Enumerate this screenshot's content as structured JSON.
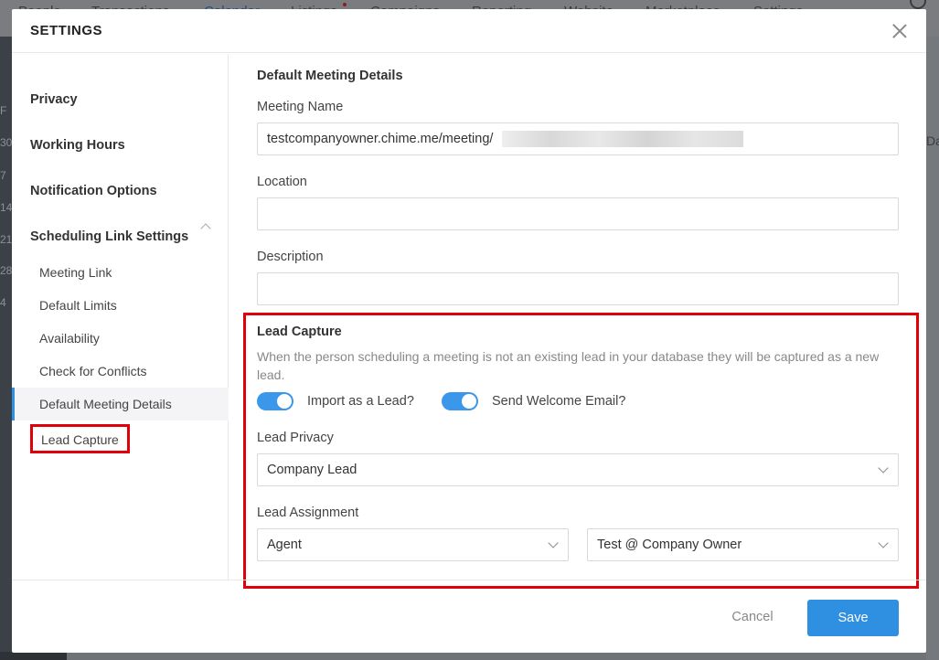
{
  "background": {
    "nav": [
      "People",
      "Transactions",
      "Calendar",
      "Listings",
      "Campaigns",
      "Reporting",
      "Website",
      "Marketplace",
      "Settings"
    ],
    "active_nav": "Calendar",
    "rail_numbers": [
      "F",
      "30",
      "7",
      "14",
      "21",
      "28",
      "4"
    ],
    "right_text": "Da"
  },
  "modal": {
    "title": "SETTINGS",
    "close_icon": "close-icon"
  },
  "sidebar": {
    "privacy": "Privacy",
    "working_hours": "Working Hours",
    "notification_options": "Notification Options",
    "scheduling_link_settings": "Scheduling Link Settings",
    "sub": [
      "Meeting Link",
      "Default Limits",
      "Availability",
      "Check for Conflicts",
      "Default Meeting Details",
      "Lead Capture"
    ]
  },
  "meeting": {
    "section_title": "Default Meeting Details",
    "name_label": "Meeting Name",
    "name_value": "testcompanyowner.chime.me/meeting/",
    "location_label": "Location",
    "location_value": "",
    "description_label": "Description",
    "description_value": ""
  },
  "lead_capture": {
    "title": "Lead Capture",
    "description": "When the person scheduling a meeting is not an existing lead in your database they will be captured as a new lead.",
    "import_toggle_label": "Import as a Lead?",
    "import_toggle_on": true,
    "welcome_toggle_label": "Send Welcome Email?",
    "welcome_toggle_on": true,
    "privacy_label": "Lead Privacy",
    "privacy_value": "Company Lead",
    "assignment_label": "Lead Assignment",
    "assignment_type": "Agent",
    "assignment_person": "Test @ Company Owner"
  },
  "footer": {
    "cancel": "Cancel",
    "save": "Save"
  },
  "colors": {
    "accent": "#2f8fe0",
    "highlight": "#e0000a"
  }
}
